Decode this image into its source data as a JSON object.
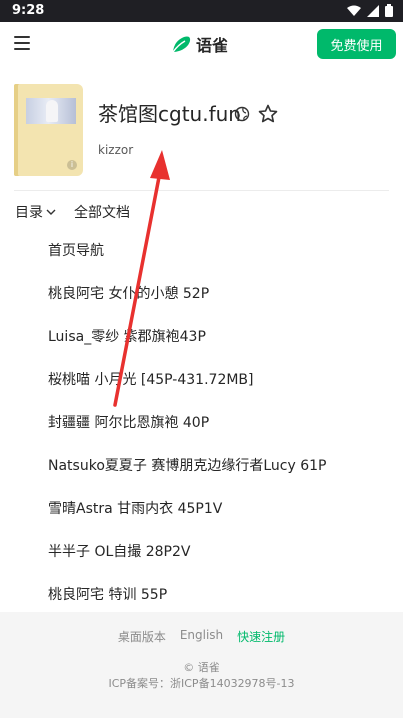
{
  "status_bar": {
    "time": "9:28"
  },
  "header": {
    "brand_name": "语雀",
    "free_button": "免费使用"
  },
  "book": {
    "title": "茶馆图cgtu.fun",
    "author": "kizzor"
  },
  "tabs": {
    "catalog": "目录",
    "all_docs": "全部文档"
  },
  "toc": [
    "首页导航",
    "桃良阿宅 女仆的小憩 52P",
    "Luisa_零纱 紫郡旗袍43P",
    "桜桃喵 小月光 [45P-431.72MB]",
    "封疆疆 阿尔比恩旗袍 40P",
    "Natsuko夏夏子 赛博朋克边缘行者Lucy 61P",
    "雪晴Astra 甘雨内衣 45P1V",
    "半半子 OL自撮 28P2V",
    "桃良阿宅 特训 55P"
  ],
  "footer": {
    "desktop": "桌面版本",
    "english": "English",
    "register": "快速注册",
    "copyright": "© 语雀",
    "icp": "ICP备案号：浙ICP备14032978号-13"
  },
  "colors": {
    "accent": "#00b96b",
    "statusbar": "#1f1f24",
    "annotation_arrow": "#e8312f"
  }
}
